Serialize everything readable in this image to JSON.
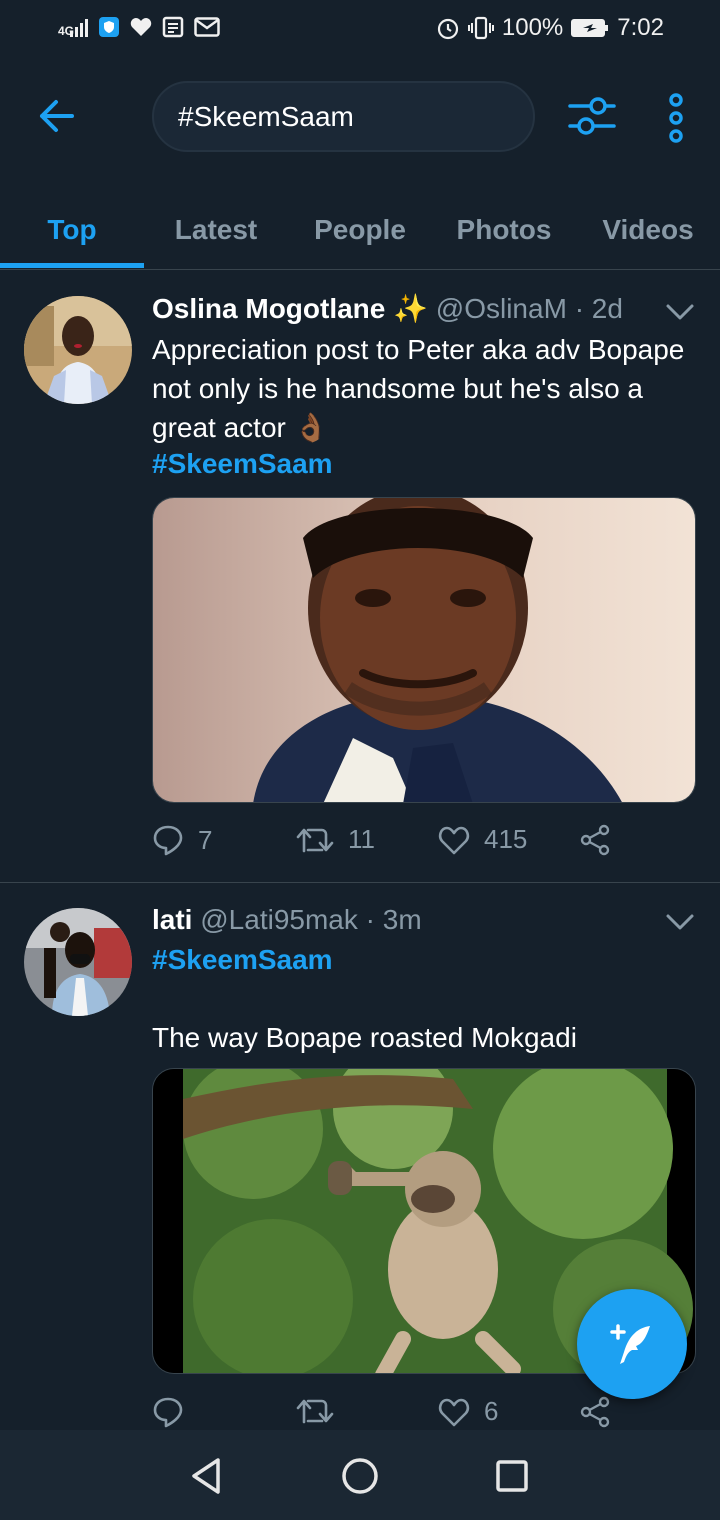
{
  "status_bar": {
    "network": "4G",
    "battery": "100%",
    "time": "7:02"
  },
  "search": {
    "query": "#SkeemSaam"
  },
  "tabs": [
    {
      "label": "Top",
      "active": true
    },
    {
      "label": "Latest",
      "active": false
    },
    {
      "label": "People",
      "active": false
    },
    {
      "label": "Photos",
      "active": false
    },
    {
      "label": "Videos",
      "active": false
    }
  ],
  "tweets": [
    {
      "name": "Oslina Mogotlane ✨",
      "handle": "@OslinaM",
      "time": "· 2d",
      "text": "Appreciation post to Peter aka adv Bopape not only is he handsome but he's also a great actor 👌🏾",
      "hashtag": "#SkeemSaam",
      "replies": "7",
      "retweets": "11",
      "likes": "415"
    },
    {
      "name": "lati",
      "handle": "@Lati95mak",
      "time": "· 3m",
      "hashtag": "#SkeemSaam",
      "text": "The way Bopape roasted Mokgadi",
      "replies": "",
      "retweets": "",
      "likes": "6"
    }
  ],
  "colors": {
    "background": "#15202b",
    "accent": "#1da1f2",
    "secondary_text": "#8899a6"
  }
}
